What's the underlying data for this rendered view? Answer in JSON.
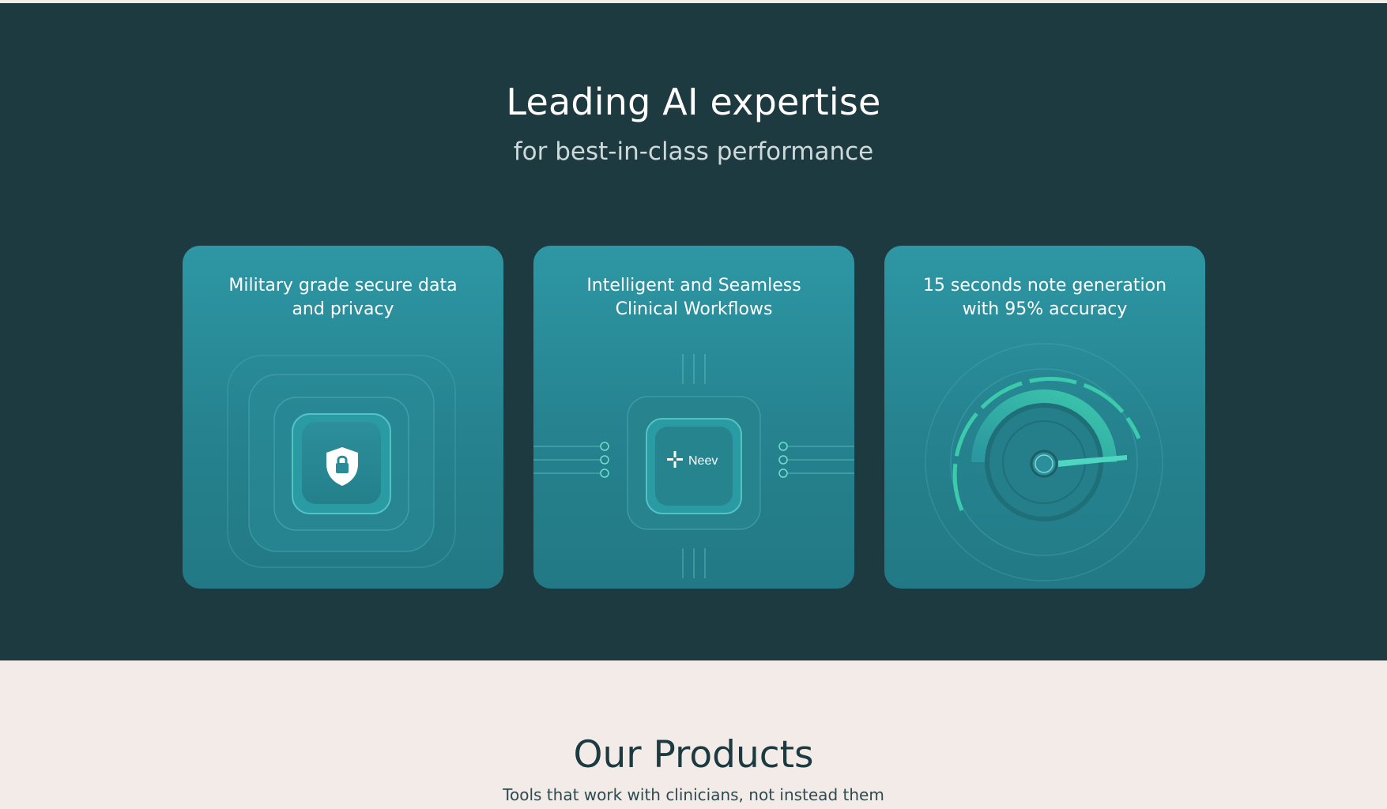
{
  "hero": {
    "title": "Leading AI expertise",
    "subtitle": "for best-in-class performance"
  },
  "features": [
    {
      "title": "Military grade secure data and privacy",
      "icon": "shield-lock-icon"
    },
    {
      "title": "Intelligent and Seamless Clinical Workflows",
      "icon": "neev-chip-icon",
      "logo_text": "Neev"
    },
    {
      "title": "15 seconds note generation with 95% accuracy",
      "icon": "speed-gauge-icon"
    }
  ],
  "products": {
    "title": "Our Products",
    "subtitle": "Tools that work with clinicians, not instead them"
  },
  "colors": {
    "dark_teal": "#1c3a40",
    "card_teal": "#2e97a4",
    "accent_green": "#3fd1b0",
    "beige": "#f2ebe7"
  }
}
